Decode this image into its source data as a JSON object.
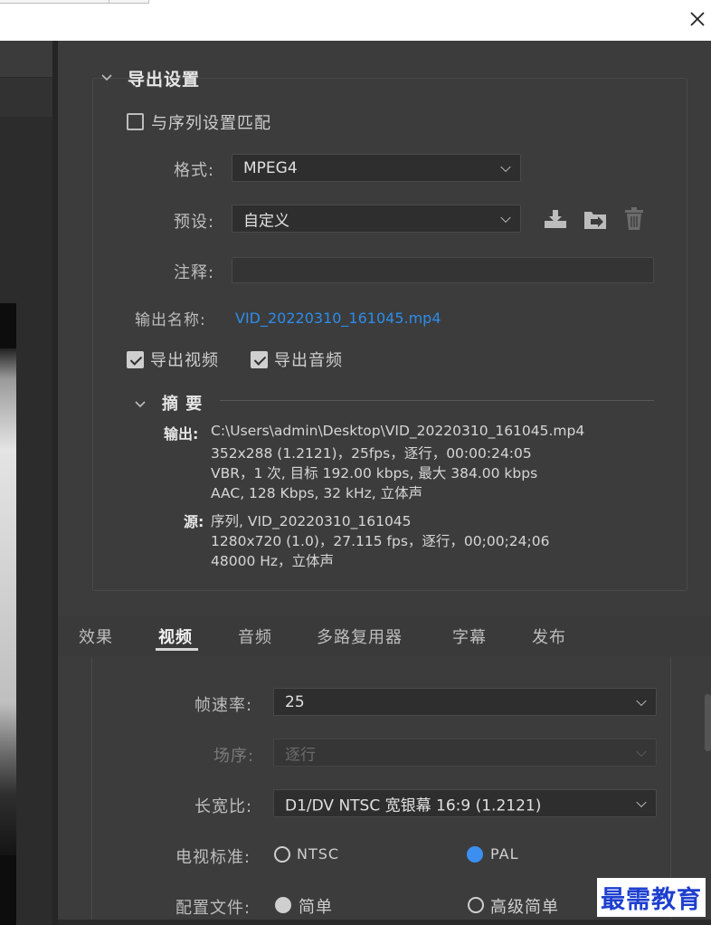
{
  "window": {
    "close_label": "×"
  },
  "export_settings": {
    "title": "导出设置",
    "match_sequence_label": "与序列设置匹配",
    "match_sequence_checked": false,
    "format": {
      "label": "格式:",
      "value": "MPEG4"
    },
    "preset": {
      "label": "预设:",
      "value": "自定义",
      "icons": [
        "save-preset-icon",
        "import-preset-icon",
        "delete-preset-icon"
      ]
    },
    "comments": {
      "label": "注释:",
      "value": ""
    },
    "output_name": {
      "label": "输出名称:",
      "value": "VID_20220310_161045.mp4"
    },
    "export_video": {
      "label": "导出视频",
      "checked": true
    },
    "export_audio": {
      "label": "导出音频",
      "checked": true
    },
    "summary": {
      "title": "摘 要",
      "output_key": "输出:",
      "output_lines": [
        "C:\\Users\\admin\\Desktop\\VID_20220310_161045.mp4",
        "352x288 (1.2121)，25fps，逐行，00:00:24:05",
        "VBR，1 次, 目标 192.00 kbps, 最大 384.00 kbps",
        "AAC, 128 Kbps, 32  kHz, 立体声"
      ],
      "source_key": "源:",
      "source_lines": [
        "序列, VID_20220310_161045",
        "1280x720 (1.0)，27.115  fps，逐行，00;00;24;06",
        "48000 Hz，立体声"
      ]
    }
  },
  "tabs": [
    {
      "label": "效果",
      "active": false
    },
    {
      "label": "视频",
      "active": true
    },
    {
      "label": "音频",
      "active": false
    },
    {
      "label": "多路复用器",
      "active": false
    },
    {
      "label": "字幕",
      "active": false
    },
    {
      "label": "发布",
      "active": false
    }
  ],
  "video": {
    "frame_rate": {
      "label": "帧速率:",
      "value": "25"
    },
    "field_order": {
      "label": "场序:",
      "value": "逐行",
      "disabled": true
    },
    "aspect": {
      "label": "长宽比:",
      "value": "D1/DV NTSC 宽银幕 16:9 (1.2121)"
    },
    "tv_standard": {
      "label": "电视标准:",
      "options": [
        "NTSC",
        "PAL"
      ],
      "selected": "PAL"
    },
    "profile": {
      "label": "配置文件:",
      "options": [
        "简单",
        "高级简单"
      ],
      "selected": "简单"
    }
  },
  "watermark": "最需教育",
  "colors": {
    "panel_bg": "#3c3c3c",
    "link": "#2d8ceb",
    "radio_selected": "#3b8ff0"
  }
}
